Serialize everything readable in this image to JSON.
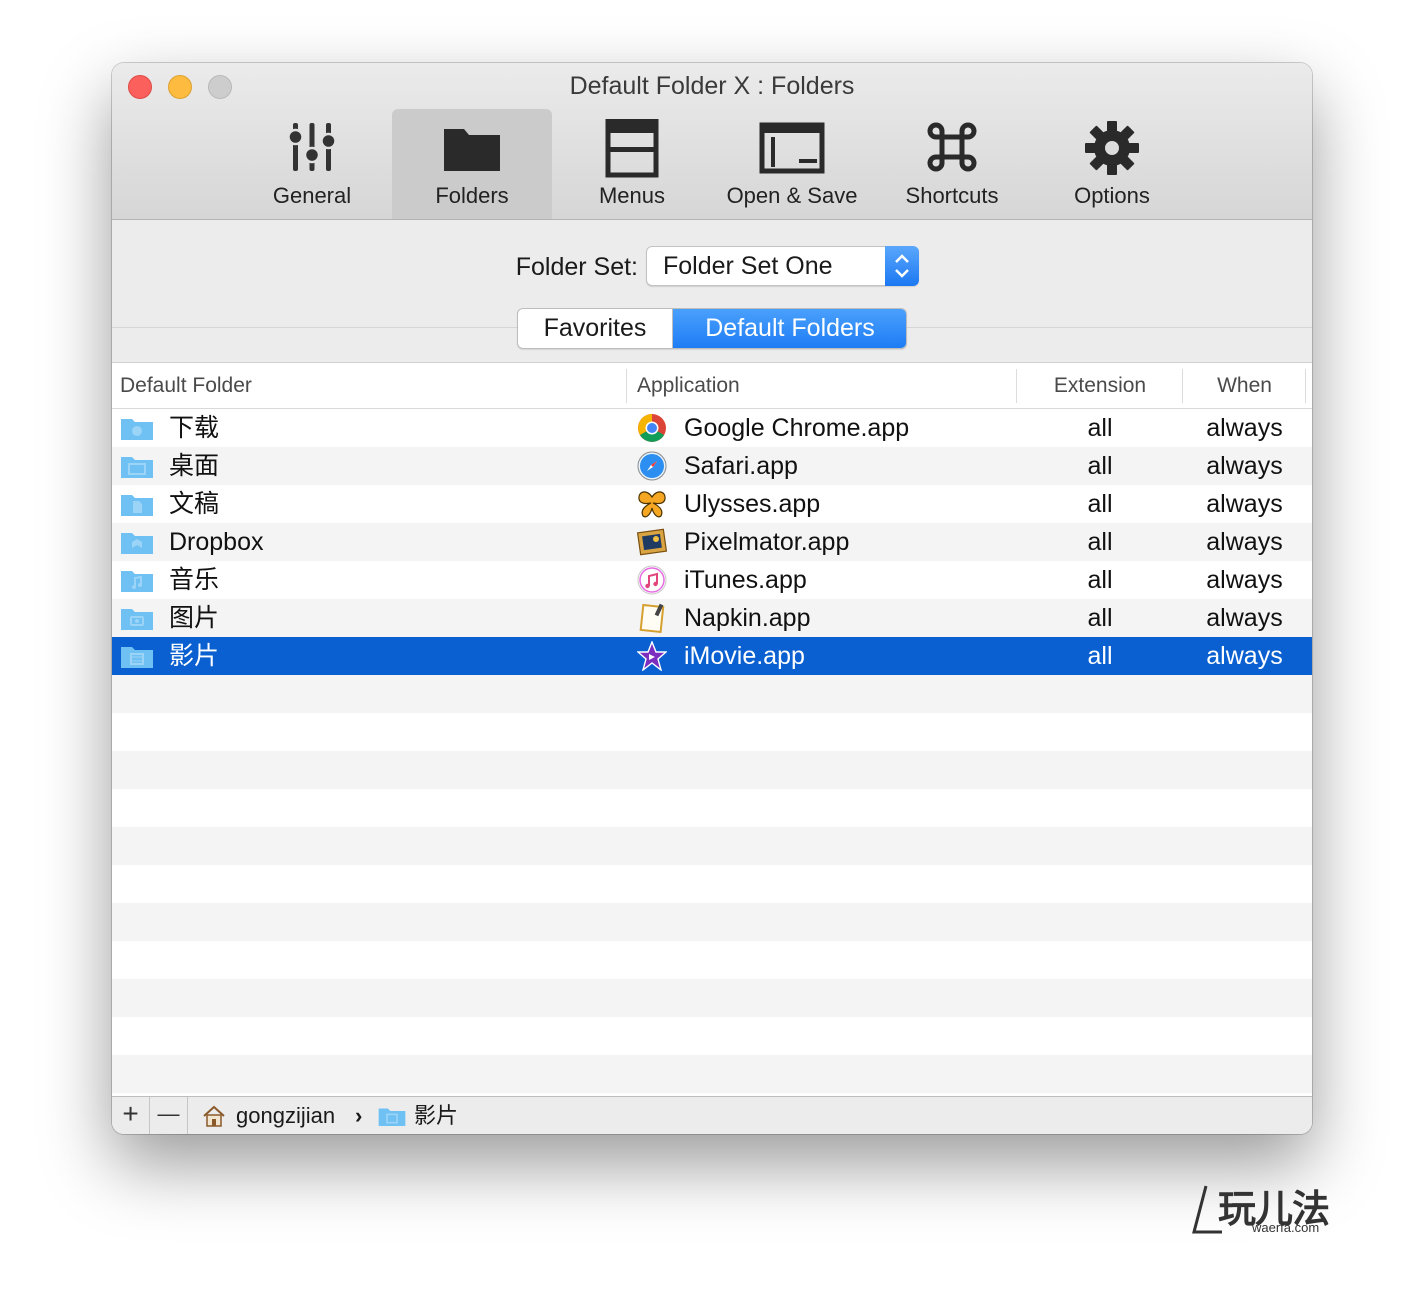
{
  "window": {
    "title": "Default Folder X : Folders"
  },
  "toolbar": {
    "items": [
      {
        "label": "General",
        "icon": "sliders-icon"
      },
      {
        "label": "Folders",
        "icon": "folder-icon",
        "active": true
      },
      {
        "label": "Menus",
        "icon": "menus-icon"
      },
      {
        "label": "Open & Save",
        "icon": "open-save-icon"
      },
      {
        "label": "Shortcuts",
        "icon": "command-icon"
      },
      {
        "label": "Options",
        "icon": "gear-icon"
      }
    ]
  },
  "folder_set": {
    "label": "Folder Set:",
    "value": "Folder Set One"
  },
  "segments": {
    "favorites": "Favorites",
    "default_folders": "Default Folders",
    "selected": "Default Folders"
  },
  "table": {
    "headers": {
      "folder": "Default Folder",
      "application": "Application",
      "extension": "Extension",
      "when": "When"
    },
    "rows": [
      {
        "folder": "下载",
        "folder_icon": "downloads-folder-icon",
        "app": "Google Chrome.app",
        "app_icon": "chrome-icon",
        "ext": "all",
        "when": "always"
      },
      {
        "folder": "桌面",
        "folder_icon": "desktop-folder-icon",
        "app": "Safari.app",
        "app_icon": "safari-icon",
        "ext": "all",
        "when": "always"
      },
      {
        "folder": "文稿",
        "folder_icon": "documents-folder-icon",
        "app": "Ulysses.app",
        "app_icon": "ulysses-butterfly-icon",
        "ext": "all",
        "when": "always"
      },
      {
        "folder": "Dropbox",
        "folder_icon": "dropbox-folder-icon",
        "app": "Pixelmator.app",
        "app_icon": "pixelmator-icon",
        "ext": "all",
        "when": "always"
      },
      {
        "folder": "音乐",
        "folder_icon": "music-folder-icon",
        "app": "iTunes.app",
        "app_icon": "itunes-icon",
        "ext": "all",
        "when": "always"
      },
      {
        "folder": "图片",
        "folder_icon": "pictures-folder-icon",
        "app": "Napkin.app",
        "app_icon": "napkin-icon",
        "ext": "all",
        "when": "always"
      },
      {
        "folder": "影片",
        "folder_icon": "movies-folder-icon",
        "app": "iMovie.app",
        "app_icon": "imovie-star-icon",
        "ext": "all",
        "when": "always",
        "selected": true
      }
    ]
  },
  "bottom_bar": {
    "add": "+",
    "remove": "—",
    "path": [
      "gongzijian",
      "影片"
    ],
    "separator": "›"
  },
  "watermark": {
    "text": "玩儿法",
    "sub": "waerfa.com"
  },
  "colors": {
    "selection": "#0a60d0",
    "accent": "#1e7df5",
    "close": "#fc605c",
    "minimize": "#fdbc40",
    "folder": "#6fc1f3"
  }
}
